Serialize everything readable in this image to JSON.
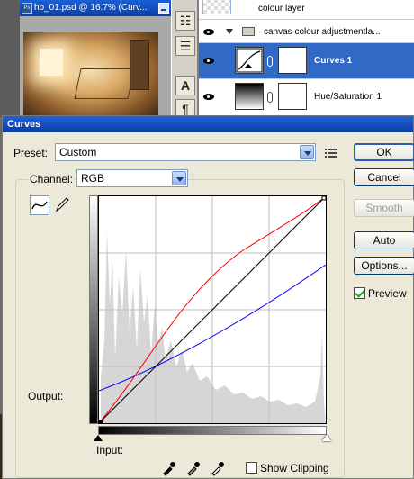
{
  "document": {
    "title": "hb_01.psd @ 16.7% (Curv..."
  },
  "layers": {
    "items": [
      {
        "name": "colour layer"
      },
      {
        "name": "canvas colour adjustmentla..."
      },
      {
        "name": "Curves 1",
        "selected": true
      },
      {
        "name": "Hue/Saturation 1"
      }
    ]
  },
  "dialog": {
    "title": "Curves",
    "preset_label": "Preset:",
    "preset_value": "Custom",
    "channel_label": "Channel:",
    "channel_value": "RGB",
    "output_label": "Output:",
    "input_label": "Input:",
    "buttons": {
      "ok": "OK",
      "cancel": "Cancel",
      "smooth": "Smooth",
      "auto": "Auto",
      "options": "Options..."
    },
    "preview_label": "Preview",
    "preview_checked": true,
    "show_clipping_label": "Show Clipping",
    "show_clipping_checked": false
  },
  "colors": {
    "title_blue": "#0b3fa8",
    "selection_blue": "#3169c6",
    "curve_red": "#ff0000",
    "curve_blue": "#0000ff",
    "curve_rgb": "#000000"
  }
}
